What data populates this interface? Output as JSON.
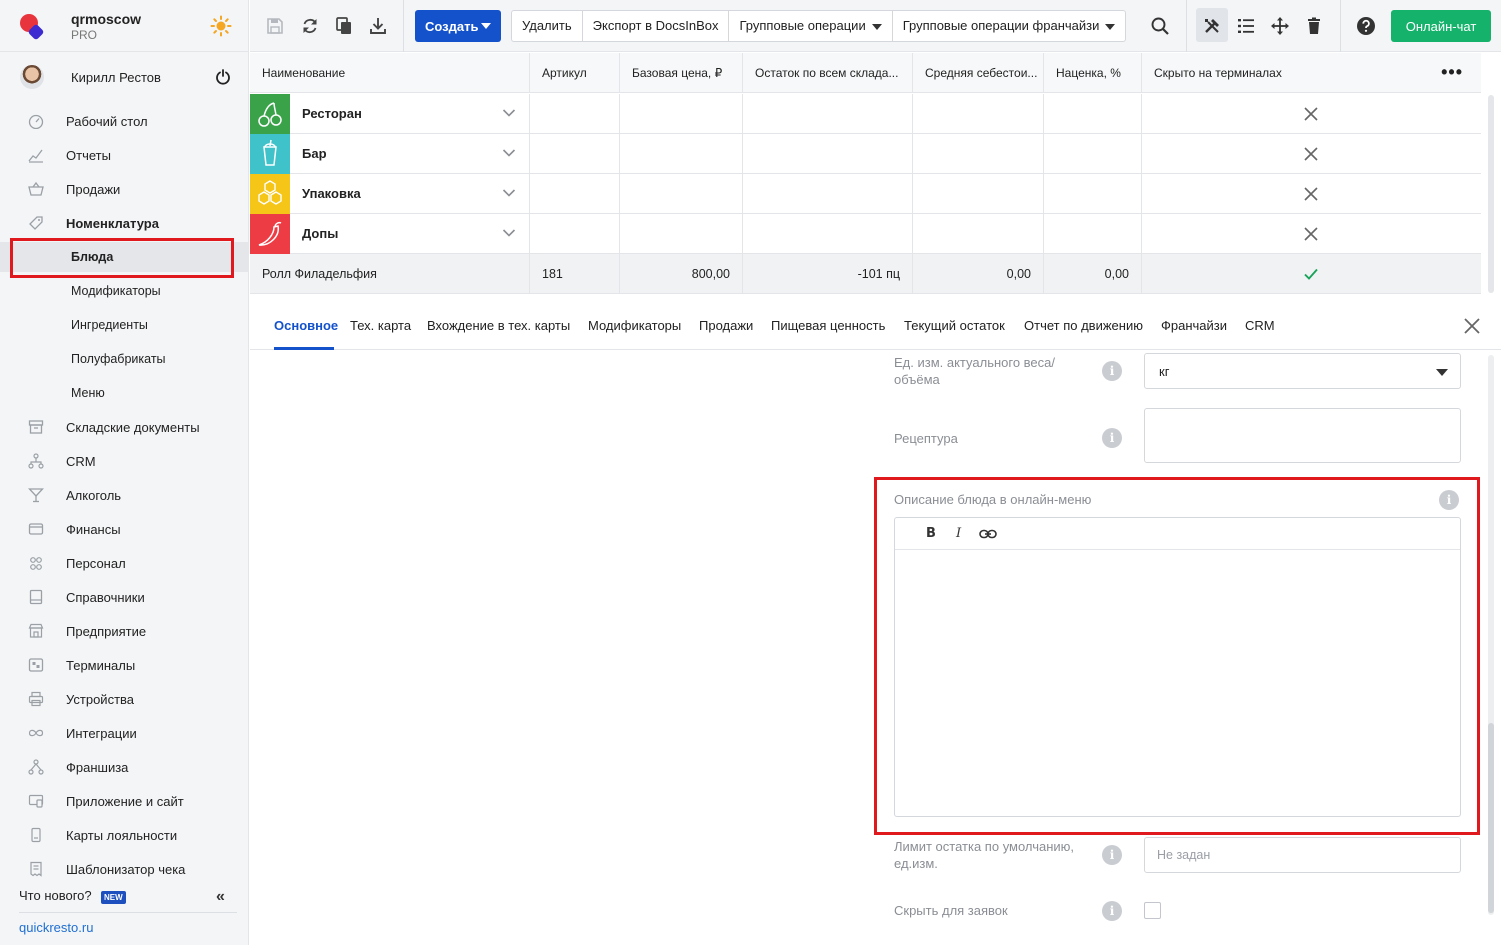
{
  "brand": {
    "name": "qrmoscow",
    "plan": "PRO"
  },
  "user": {
    "name": "Кирилл Рестов"
  },
  "sidebar": {
    "items": [
      {
        "label": "Рабочий стол",
        "icon": "dashboard-icon"
      },
      {
        "label": "Отчеты",
        "icon": "reports-icon"
      },
      {
        "label": "Продажи",
        "icon": "basket-icon"
      },
      {
        "label": "Номенклатура",
        "icon": "tag-icon"
      },
      {
        "label": "Блюда"
      },
      {
        "label": "Модификаторы"
      },
      {
        "label": "Ингредиенты"
      },
      {
        "label": "Полуфабрикаты"
      },
      {
        "label": "Меню"
      },
      {
        "label": "Складские документы",
        "icon": "warehouse-icon"
      },
      {
        "label": "CRM",
        "icon": "crm-icon"
      },
      {
        "label": "Алкоголь",
        "icon": "cocktail-icon"
      },
      {
        "label": "Финансы",
        "icon": "wallet-icon"
      },
      {
        "label": "Персонал",
        "icon": "staff-icon"
      },
      {
        "label": "Справочники",
        "icon": "book-icon"
      },
      {
        "label": "Предприятие",
        "icon": "store-icon"
      },
      {
        "label": "Терминалы",
        "icon": "terminal-icon"
      },
      {
        "label": "Устройства",
        "icon": "printer-icon"
      },
      {
        "label": "Интеграции",
        "icon": "infinity-icon"
      },
      {
        "label": "Франшиза",
        "icon": "franchise-icon"
      },
      {
        "label": "Приложение и сайт",
        "icon": "app-icon"
      },
      {
        "label": "Карты лояльности",
        "icon": "card-icon"
      },
      {
        "label": "Шаблонизатор чека",
        "icon": "receipt-icon"
      }
    ],
    "whats_new": "Что нового?",
    "new_badge": "NEW",
    "collapse": "«",
    "site_link": "quickresto.ru"
  },
  "toolbar": {
    "create": "Создать",
    "group": [
      "Удалить",
      "Экспорт в DocsInBox",
      "Групповые операции",
      "Групповые операции франчайзи"
    ],
    "chat": "Онлайн-чат"
  },
  "table": {
    "columns": [
      "Наименование",
      "Артикул",
      "Базовая цена, ₽",
      "Остаток по всем склада...",
      "Средняя себестои...",
      "Наценка, %",
      "Скрыто на терминалах"
    ],
    "categories": [
      {
        "label": "Ресторан",
        "color": "#3aa34a",
        "icon": "cherries-icon"
      },
      {
        "label": "Бар",
        "color": "#3fc2c9",
        "icon": "drink-cup-icon"
      },
      {
        "label": "Упаковка",
        "color": "#f5c518",
        "icon": "hexagons-icon"
      },
      {
        "label": "Допы",
        "color": "#ee3c45",
        "icon": "chili-icon"
      }
    ],
    "item": {
      "name": "Ролл Филадельфия",
      "article": "181",
      "price": "800,00",
      "stock": "-101 пц",
      "cost": "0,00",
      "markup": "0,00"
    }
  },
  "tabs": [
    "Основное",
    "Тех. карта",
    "Вхождение в тех. карты",
    "Модификаторы",
    "Продажи",
    "Пищевая ценность",
    "Текущий остаток",
    "Отчет по движению",
    "Франчайзи",
    "CRM"
  ],
  "form": {
    "unit_label": "Ед. изм. актуального веса/ объёма",
    "unit_value": "кг",
    "recipe_label": "Рецептура",
    "desc_label": "Описание блюда в онлайн-меню",
    "editor_tools": [
      "B",
      "I"
    ],
    "limit_label": "Лимит остатка по умолчанию, ед.изм.",
    "limit_placeholder": "Не задан",
    "hide_label": "Скрыть для заявок"
  },
  "colors": {
    "accent": "#1452cc",
    "chat": "#15b26b",
    "highlight": "#e0191e"
  }
}
